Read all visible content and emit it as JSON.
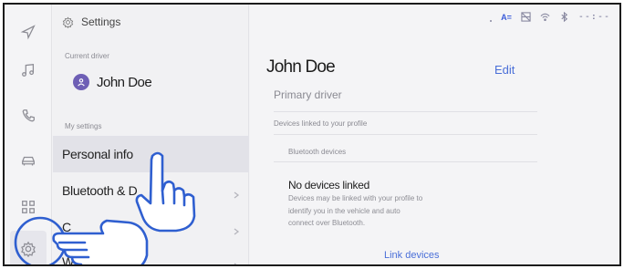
{
  "rail": {
    "items": [
      {
        "name": "navigation-icon"
      },
      {
        "name": "music-icon"
      },
      {
        "name": "phone-icon"
      },
      {
        "name": "car-icon"
      },
      {
        "name": "apps-icon"
      },
      {
        "name": "gear-icon",
        "active": true
      }
    ]
  },
  "settings": {
    "title": "Settings",
    "current_driver_caption": "Current driver",
    "driver_name": "John Doe",
    "my_settings_caption": "My settings",
    "menu": [
      {
        "label": "Personal info",
        "selected": true
      },
      {
        "label": "Bluetooth & D"
      },
      {
        "label": "C"
      },
      {
        "label": "Wi-"
      }
    ]
  },
  "status_bar": {
    "az_label": "A=",
    "time": "--:--"
  },
  "detail": {
    "name": "John Doe",
    "edit_label": "Edit",
    "role": "Primary driver",
    "devices_caption": "Devices linked to your profile",
    "bluetooth_caption": "Bluetooth devices",
    "no_devices": "No devices linked",
    "description": "Devices may be linked with your profile to identify you in the vehicle and auto connect over Bluetooth.",
    "link_devices": "Link devices"
  },
  "colors": {
    "accent": "#4a6fd8",
    "avatar": "#6e5fb5",
    "hand_fill": "#ffffff",
    "hand_stroke": "#2f5fd0"
  }
}
